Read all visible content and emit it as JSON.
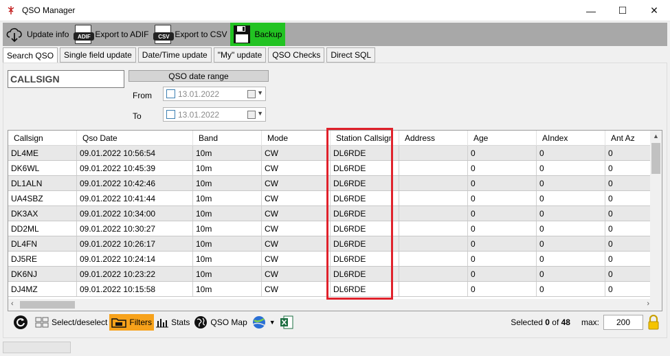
{
  "window": {
    "title": "QSO Manager",
    "minimize": "—",
    "maximize": "☐",
    "close": "✕"
  },
  "toolbar": {
    "update_info": "Update info",
    "export_adif": "Export to ADIF",
    "export_csv": "Export to CSV",
    "backup": "Backup",
    "adif_badge": "ADIF",
    "csv_badge": "CSV"
  },
  "tabs": [
    "Search QSO",
    "Single field update",
    "Date/Time update",
    "\"My\" update",
    "QSO Checks",
    "Direct SQL"
  ],
  "search": {
    "callsign_value": "CALLSIGN",
    "date_range_label": "QSO date range",
    "from_label": "From",
    "to_label": "To",
    "from_value": "13.01.2022",
    "to_value": "13.01.2022"
  },
  "grid": {
    "columns": [
      "Callsign",
      "Qso Date",
      "Band",
      "Mode",
      "Station Callsign",
      "Address",
      "Age",
      "AIndex",
      "Ant Az"
    ],
    "rows": [
      [
        "DL4ME",
        "09.01.2022 10:56:54",
        "10m",
        "CW",
        "DL6RDE",
        "",
        "0",
        "0",
        "0"
      ],
      [
        "DK6WL",
        "09.01.2022 10:45:39",
        "10m",
        "CW",
        "DL6RDE",
        "",
        "0",
        "0",
        "0"
      ],
      [
        "DL1ALN",
        "09.01.2022 10:42:46",
        "10m",
        "CW",
        "DL6RDE",
        "",
        "0",
        "0",
        "0"
      ],
      [
        "UA4SBZ",
        "09.01.2022 10:41:44",
        "10m",
        "CW",
        "DL6RDE",
        "",
        "0",
        "0",
        "0"
      ],
      [
        "DK3AX",
        "09.01.2022 10:34:00",
        "10m",
        "CW",
        "DL6RDE",
        "",
        "0",
        "0",
        "0"
      ],
      [
        "DD2ML",
        "09.01.2022 10:30:27",
        "10m",
        "CW",
        "DL6RDE",
        "",
        "0",
        "0",
        "0"
      ],
      [
        "DL4FN",
        "09.01.2022 10:26:17",
        "10m",
        "CW",
        "DL6RDE",
        "",
        "0",
        "0",
        "0"
      ],
      [
        "DJ5RE",
        "09.01.2022 10:24:14",
        "10m",
        "CW",
        "DL6RDE",
        "",
        "0",
        "0",
        "0"
      ],
      [
        "DK6NJ",
        "09.01.2022 10:23:22",
        "10m",
        "CW",
        "DL6RDE",
        "",
        "0",
        "0",
        "0"
      ],
      [
        "DJ4MZ",
        "09.01.2022 10:15:58",
        "10m",
        "CW",
        "DL6RDE",
        "",
        "0",
        "0",
        "0"
      ]
    ]
  },
  "bottom": {
    "select_deselect": "Select/deselect",
    "filters": "Filters",
    "stats": "Stats",
    "qso_map": "QSO Map",
    "selected_label": "Selected",
    "selected_count": "0",
    "of_label": "of",
    "total_count": "48",
    "max_label": "max:",
    "max_value": "200"
  },
  "colors": {
    "backup_bg": "#22c322",
    "filters_bg": "#f7a21b",
    "highlight": "#e0212b",
    "toolbar_bg": "#a8a8a8"
  }
}
